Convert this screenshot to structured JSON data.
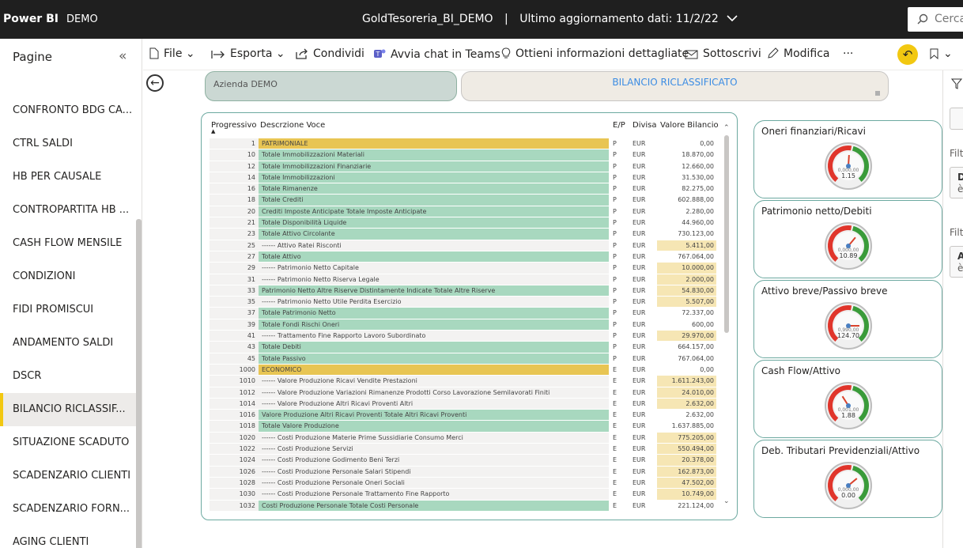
{
  "topbar": {
    "brand": "Power BI",
    "workspace": "DEMO",
    "report_title": "GoldTesoreria_BI_DEMO",
    "separator": "|",
    "last_update": "Ultimo aggiornamento dati: 11/2/22",
    "search_placeholder": "Cerca"
  },
  "pages": {
    "header": "Pagine",
    "items": [
      {
        "label": "CONFRONTO BDG CA..."
      },
      {
        "label": "CTRL SALDI"
      },
      {
        "label": "HB PER CAUSALE"
      },
      {
        "label": "CONTROPARTITA HB ..."
      },
      {
        "label": "CASH FLOW MENSILE"
      },
      {
        "label": "CONDIZIONI"
      },
      {
        "label": "FIDI PROMISCUI"
      },
      {
        "label": "ANDAMENTO SALDI"
      },
      {
        "label": "DSCR"
      },
      {
        "label": "BILANCIO RICLASSIF..."
      },
      {
        "label": "SITUAZIONE SCADUTO"
      },
      {
        "label": "SCADENZARIO CLIENTI"
      },
      {
        "label": "SCADENZARIO FORN..."
      },
      {
        "label": "AGING CLIENTI"
      }
    ],
    "active_index": 9
  },
  "toolbar": {
    "file": "File",
    "export": "Esporta",
    "share": "Condividi",
    "teams": "Avvia chat in Teams",
    "insights": "Ottieni informazioni dettagliate",
    "subscribe": "Sottoscrivi",
    "edit": "Modifica",
    "more": "···"
  },
  "slicers": {
    "company": "Azienda DEMO",
    "page_title": "BILANCIO RICLASSIFICATO"
  },
  "table": {
    "headers": {
      "prog": "Progressivo",
      "desc": "Descrzione Voce",
      "ep": "E/P",
      "currency": "Divisa",
      "value": "Valore Bilancio"
    },
    "rows": [
      {
        "prog": "1",
        "desc": "PATRIMONIALE",
        "ep": "P",
        "cur": "EUR",
        "val": "0,00",
        "kind": "sec",
        "hl": false
      },
      {
        "prog": "10",
        "desc": "Totale Immobilizzazioni Materiali",
        "ep": "P",
        "cur": "EUR",
        "val": "18.870,00",
        "kind": "tot",
        "hl": false
      },
      {
        "prog": "12",
        "desc": "Totale Immobilizzazioni Finanziarie",
        "ep": "P",
        "cur": "EUR",
        "val": "12.660,00",
        "kind": "tot",
        "hl": false
      },
      {
        "prog": "14",
        "desc": "Totale Immobilizzazioni",
        "ep": "P",
        "cur": "EUR",
        "val": "31.530,00",
        "kind": "tot",
        "hl": false
      },
      {
        "prog": "16",
        "desc": "Totale Rimanenze",
        "ep": "P",
        "cur": "EUR",
        "val": "82.275,00",
        "kind": "tot",
        "hl": false
      },
      {
        "prog": "18",
        "desc": "Totale Crediti",
        "ep": "P",
        "cur": "EUR",
        "val": "602.888,00",
        "kind": "tot",
        "hl": false
      },
      {
        "prog": "20",
        "desc": "Crediti Imposte Anticipate Totale Imposte Anticipate",
        "ep": "P",
        "cur": "EUR",
        "val": "2.280,00",
        "kind": "tot",
        "hl": false
      },
      {
        "prog": "21",
        "desc": "Totale Disponibilità Liquide",
        "ep": "P",
        "cur": "EUR",
        "val": "44.960,00",
        "kind": "tot",
        "hl": false
      },
      {
        "prog": "23",
        "desc": "Totale Attivo Circolante",
        "ep": "P",
        "cur": "EUR",
        "val": "730.123,00",
        "kind": "tot",
        "hl": false
      },
      {
        "prog": "25",
        "desc": "------ Attivo Ratei Risconti",
        "ep": "P",
        "cur": "EUR",
        "val": "5.411,00",
        "kind": "",
        "hl": true
      },
      {
        "prog": "27",
        "desc": "Totale Attivo",
        "ep": "P",
        "cur": "EUR",
        "val": "767.064,00",
        "kind": "tot",
        "hl": false
      },
      {
        "prog": "29",
        "desc": "------ Patrimonio Netto Capitale",
        "ep": "P",
        "cur": "EUR",
        "val": "10.000,00",
        "kind": "",
        "hl": true
      },
      {
        "prog": "31",
        "desc": "------ Patrimonio Netto Riserva Legale",
        "ep": "P",
        "cur": "EUR",
        "val": "2.000,00",
        "kind": "",
        "hl": true
      },
      {
        "prog": "33",
        "desc": "Patrimonio Netto Altre Riserve Distintamente Indicate Totale Altre Riserve",
        "ep": "P",
        "cur": "EUR",
        "val": "54.830,00",
        "kind": "tot",
        "hl": true
      },
      {
        "prog": "35",
        "desc": "------ Patrimonio Netto Utile Perdita Esercizio",
        "ep": "P",
        "cur": "EUR",
        "val": "5.507,00",
        "kind": "",
        "hl": true
      },
      {
        "prog": "37",
        "desc": "Totale Patrimonio Netto",
        "ep": "P",
        "cur": "EUR",
        "val": "72.337,00",
        "kind": "tot",
        "hl": false
      },
      {
        "prog": "39",
        "desc": "Totale Fondi Rischi Oneri",
        "ep": "P",
        "cur": "EUR",
        "val": "600,00",
        "kind": "tot",
        "hl": false
      },
      {
        "prog": "41",
        "desc": "------ Trattamento Fine Rapporto Lavoro Subordinato",
        "ep": "P",
        "cur": "EUR",
        "val": "29.970,00",
        "kind": "",
        "hl": true
      },
      {
        "prog": "43",
        "desc": "Totale Debiti",
        "ep": "P",
        "cur": "EUR",
        "val": "664.157,00",
        "kind": "tot",
        "hl": false
      },
      {
        "prog": "45",
        "desc": "Totale Passivo",
        "ep": "P",
        "cur": "EUR",
        "val": "767.064,00",
        "kind": "tot",
        "hl": false
      },
      {
        "prog": "1000",
        "desc": "ECONOMICO",
        "ep": "E",
        "cur": "EUR",
        "val": "0,00",
        "kind": "sec",
        "hl": false
      },
      {
        "prog": "1010",
        "desc": "------ Valore Produzione Ricavi Vendite Prestazioni",
        "ep": "E",
        "cur": "EUR",
        "val": "1.611.243,00",
        "kind": "",
        "hl": true
      },
      {
        "prog": "1012",
        "desc": "------ Valore Produzione Variazioni Rimanenze Prodotti Corso Lavorazione Semilavorati Finiti",
        "ep": "E",
        "cur": "EUR",
        "val": "24.010,00",
        "kind": "",
        "hl": true
      },
      {
        "prog": "1014",
        "desc": "------ Valore Produzione Altri Ricavi Proventi Altri",
        "ep": "E",
        "cur": "EUR",
        "val": "2.632,00",
        "kind": "",
        "hl": true
      },
      {
        "prog": "1016",
        "desc": "Valore Produzione Altri Ricavi Proventi Totale Altri Ricavi Proventi",
        "ep": "E",
        "cur": "EUR",
        "val": "2.632,00",
        "kind": "tot",
        "hl": false
      },
      {
        "prog": "1018",
        "desc": "Totale Valore Produzione",
        "ep": "E",
        "cur": "EUR",
        "val": "1.637.885,00",
        "kind": "tot",
        "hl": false
      },
      {
        "prog": "1020",
        "desc": "------ Costi Produzione Materie Prime Sussidiarie Consumo Merci",
        "ep": "E",
        "cur": "EUR",
        "val": "775.205,00",
        "kind": "",
        "hl": true
      },
      {
        "prog": "1022",
        "desc": "------ Costi Produzione Servizi",
        "ep": "E",
        "cur": "EUR",
        "val": "550.494,00",
        "kind": "",
        "hl": true
      },
      {
        "prog": "1024",
        "desc": "------ Costi Produzione Godimento Beni Terzi",
        "ep": "E",
        "cur": "EUR",
        "val": "20.378,00",
        "kind": "",
        "hl": true
      },
      {
        "prog": "1026",
        "desc": "------ Costi Produzione Personale Salari Stipendi",
        "ep": "E",
        "cur": "EUR",
        "val": "162.873,00",
        "kind": "",
        "hl": true
      },
      {
        "prog": "1028",
        "desc": "------ Costi Produzione Personale Oneri Sociali",
        "ep": "E",
        "cur": "EUR",
        "val": "47.502,00",
        "kind": "",
        "hl": true
      },
      {
        "prog": "1030",
        "desc": "------ Costi Produzione Personale Trattamento Fine Rapporto",
        "ep": "E",
        "cur": "EUR",
        "val": "10.749,00",
        "kind": "",
        "hl": true
      },
      {
        "prog": "1032",
        "desc": "Costi Produzione Personale Totale Costi Personale",
        "ep": "E",
        "cur": "EUR",
        "val": "221.124,00",
        "kind": "tot",
        "hl": false
      }
    ]
  },
  "kpis": [
    {
      "title": "Oneri finanziari/Ricavi",
      "small": "0,000,00",
      "value": "1.15",
      "needle": 0.02
    },
    {
      "title": "Patrimonio netto/Debiti",
      "small": "0,000,00",
      "value": "10.89",
      "needle": 0.22
    },
    {
      "title": "Attivo breve/Passivo breve",
      "small": "0,990,00",
      "value": "124.70",
      "needle": 0.5
    },
    {
      "title": "Cash Flow/Attivo",
      "small": "0,001,00",
      "value": "1.88",
      "needle": -0.18
    },
    {
      "title": "Deb. Tributari Previdenziali/Attivo",
      "small": "0,000,00",
      "value": "0.00",
      "needle": 0.28
    }
  ],
  "rightpane": {
    "filters_label_1": "Filt",
    "filters_label_2": "Filt",
    "box1_a": "D",
    "box1_b": "è",
    "box2_a": "A",
    "box2_b": "è"
  },
  "colors": {
    "accent": "#f2c811",
    "total_row": "#a8d8bf",
    "section_row": "#e8c553",
    "highlight": "#f6e6b4",
    "gauge_red": "#e0352b",
    "gauge_green": "#3a9b3a"
  }
}
